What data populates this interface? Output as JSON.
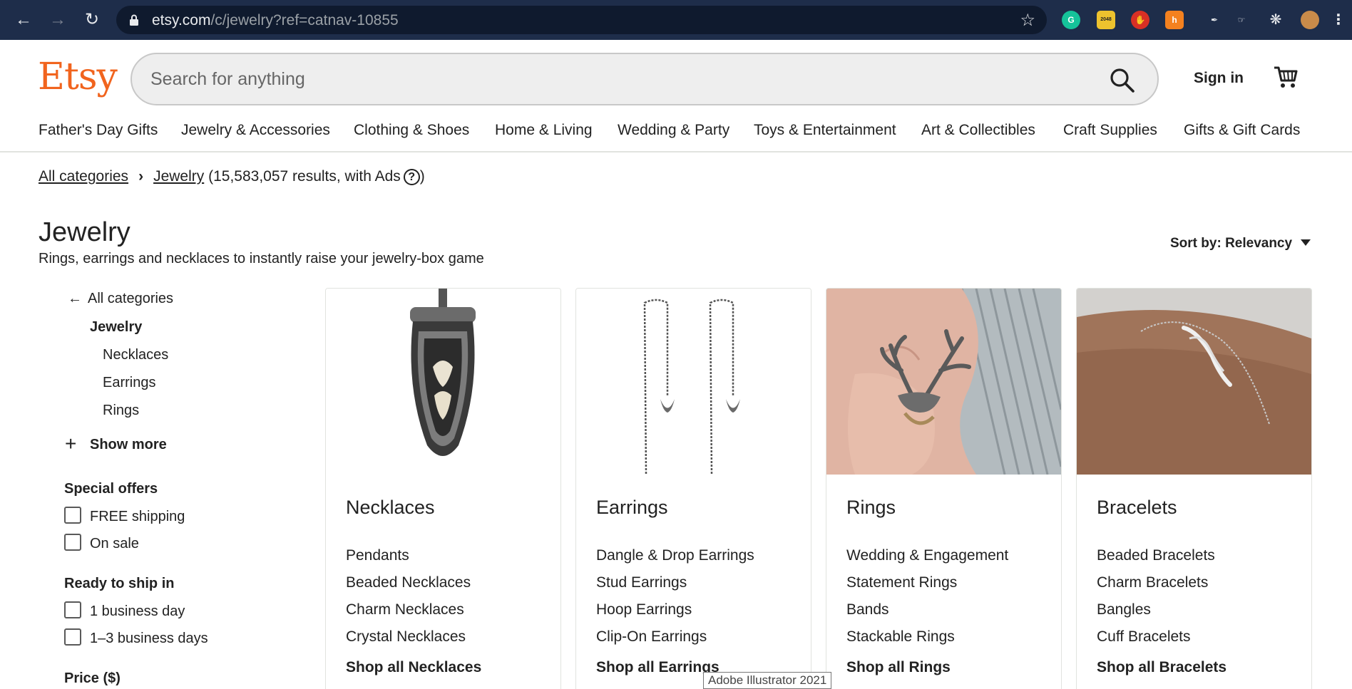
{
  "browser": {
    "url_host": "etsy.com",
    "url_path": "/c/jewelry?ref=catnav-10855"
  },
  "header": {
    "logo": "Etsy",
    "search_placeholder": "Search for anything",
    "sign_in": "Sign in"
  },
  "catnav": [
    "Father's Day Gifts",
    "Jewelry & Accessories",
    "Clothing & Shoes",
    "Home & Living",
    "Wedding & Party",
    "Toys & Entertainment",
    "Art & Collectibles",
    "Craft Supplies",
    "Gifts & Gift Cards"
  ],
  "breadcrumb": {
    "all_categories": "All categories",
    "separator": "›",
    "current": "Jewelry",
    "results": "(15,583,057 results, with Ads",
    "help": "?",
    "close_paren": ")"
  },
  "page": {
    "title": "Jewelry",
    "subtitle": "Rings, earrings and necklaces to instantly raise your jewelry-box game",
    "sort_label": "Sort by:",
    "sort_value": "Relevancy"
  },
  "sidebar": {
    "back_label": "All categories",
    "current": "Jewelry",
    "subcategories": [
      "Necklaces",
      "Earrings",
      "Rings"
    ],
    "show_more": "Show more",
    "special_offers_heading": "Special offers",
    "special_offers": [
      "FREE shipping",
      "On sale"
    ],
    "ready_heading": "Ready to ship in",
    "ready_options": [
      "1 business day",
      "1–3 business days"
    ],
    "price_heading": "Price ($)"
  },
  "cards": [
    {
      "title": "Necklaces",
      "links": [
        "Pendants",
        "Beaded Necklaces",
        "Charm Necklaces",
        "Crystal Necklaces"
      ],
      "shop_all": "Shop all Necklaces"
    },
    {
      "title": "Earrings",
      "links": [
        "Dangle & Drop Earrings",
        "Stud Earrings",
        "Hoop Earrings",
        "Clip-On Earrings"
      ],
      "shop_all": "Shop all Earrings"
    },
    {
      "title": "Rings",
      "links": [
        "Wedding & Engagement",
        "Statement Rings",
        "Bands",
        "Stackable Rings"
      ],
      "shop_all": "Shop all Rings"
    },
    {
      "title": "Bracelets",
      "links": [
        "Beaded Bracelets",
        "Charm Bracelets",
        "Bangles",
        "Cuff Bracelets"
      ],
      "shop_all": "Shop all Bracelets"
    }
  ],
  "tooltip": "Adobe Illustrator 2021",
  "colors": {
    "brand": "#f1641e",
    "chrome": "#1e2d4a"
  }
}
